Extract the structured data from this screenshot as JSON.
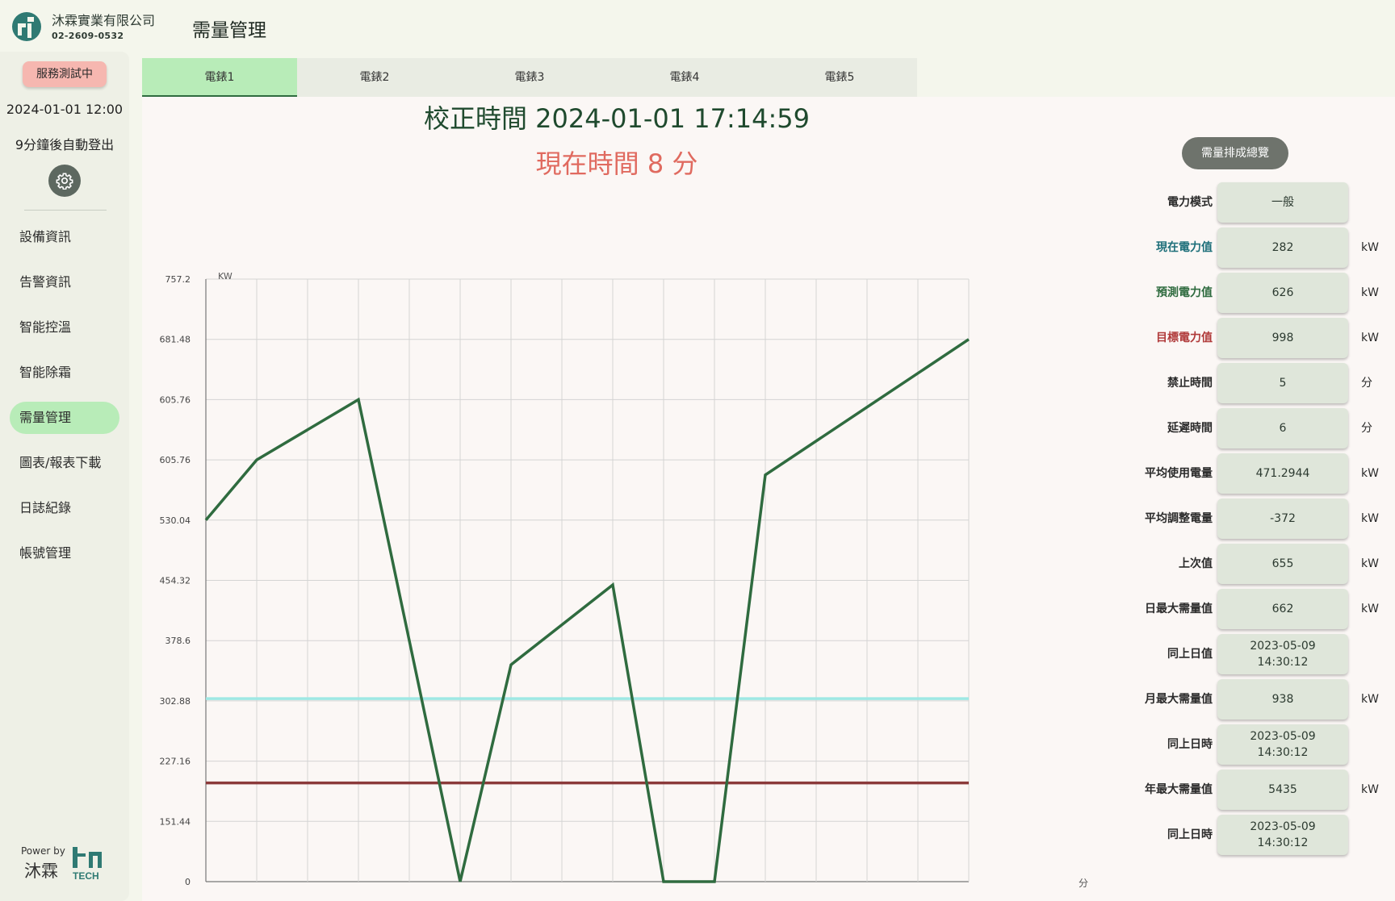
{
  "header": {
    "company": "沐霖實業有限公司",
    "phone": "02-2609-0532",
    "page_title": "需量管理"
  },
  "sidebar": {
    "status": "服務測試中",
    "datetime": "2024-01-01 12:00",
    "logout_notice": "9分鐘後自動登出",
    "items": [
      {
        "label": "設備資訊",
        "icon": "device-info"
      },
      {
        "label": "告警資訊",
        "icon": "alarm"
      },
      {
        "label": "智能控溫",
        "icon": "thermostat"
      },
      {
        "label": "智能除霜",
        "icon": "defrost"
      },
      {
        "label": "需量管理",
        "icon": "demand",
        "active": true
      },
      {
        "label": "圖表/報表下載",
        "icon": "download"
      },
      {
        "label": "日誌紀錄",
        "icon": "log"
      },
      {
        "label": "帳號管理",
        "icon": "account"
      }
    ],
    "powered_by": "Power by",
    "brand_cn": "沐霖",
    "brand_en": "TECH"
  },
  "tabs": [
    {
      "label": "電錶1",
      "active": true
    },
    {
      "label": "電錶2"
    },
    {
      "label": "電錶3"
    },
    {
      "label": "電錶4"
    },
    {
      "label": "電錶5"
    }
  ],
  "main": {
    "calibration_time": "校正時間 2024-01-01 17:14:59",
    "current_time": "現在時間 8 分",
    "summary_button": "需量排成總覽"
  },
  "params": [
    {
      "label": "電力模式",
      "value": "一般",
      "unit": "",
      "label_color": "#2b2b2b"
    },
    {
      "label": "現在電力值",
      "value": "282",
      "unit": "kW",
      "label_color": "#1e6f7a"
    },
    {
      "label": "預測電力值",
      "value": "626",
      "unit": "kW",
      "label_color": "#2f6b3f"
    },
    {
      "label": "目標電力值",
      "value": "998",
      "unit": "kW",
      "label_color": "#b03a3a"
    },
    {
      "label": "禁止時間",
      "value": "5",
      "unit": "分",
      "label_color": "#2b2b2b"
    },
    {
      "label": "延遲時間",
      "value": "6",
      "unit": "分",
      "label_color": "#2b2b2b"
    },
    {
      "label": "平均使用電量",
      "value": "471.2944",
      "unit": "kW",
      "label_color": "#2b2b2b"
    },
    {
      "label": "平均調整電量",
      "value": "-372",
      "unit": "kW",
      "label_color": "#2b2b2b"
    },
    {
      "label": "上次值",
      "value": "655",
      "unit": "kW",
      "label_color": "#2b2b2b"
    },
    {
      "label": "日最大需量值",
      "value": "662",
      "unit": "kW",
      "label_color": "#2b2b2b"
    },
    {
      "label": "同上日值",
      "value": "2023-05-09\n14:30:12",
      "unit": "",
      "label_color": "#2b2b2b"
    },
    {
      "label": "月最大需量值",
      "value": "938",
      "unit": "kW",
      "label_color": "#2b2b2b"
    },
    {
      "label": "同上日時",
      "value": "2023-05-09\n14:30:12",
      "unit": "",
      "label_color": "#2b2b2b"
    },
    {
      "label": "年最大需量值",
      "value": "5435",
      "unit": "kW",
      "label_color": "#2b2b2b"
    },
    {
      "label": "同上日時",
      "value": "2023-05-09\n14:30:12",
      "unit": "",
      "label_color": "#2b2b2b"
    }
  ],
  "chart_data": {
    "type": "line",
    "ylabel": "KW",
    "xlabel": "分",
    "y_tick_labels": [
      "0",
      "151.44",
      "227.16",
      "302.88",
      "378.6",
      "454.32",
      "530.04",
      "605.76",
      "605.76",
      "681.48",
      "757.2"
    ],
    "ylim": [
      0,
      757.2
    ],
    "x_columns": 15,
    "grid": true,
    "series": [
      {
        "color": "#2f6b3f",
        "x": [
          0,
          1,
          3,
          5,
          6,
          8,
          9,
          10,
          11,
          15
        ],
        "values": [
          454.32,
          530.04,
          605.76,
          0,
          272.6,
          372.9,
          0,
          0,
          511.1,
          681.48
        ]
      }
    ],
    "reference_lines": [
      {
        "value": 230,
        "color": "#9ee8e4"
      },
      {
        "value": 124,
        "color": "#8b3a3a"
      }
    ]
  }
}
